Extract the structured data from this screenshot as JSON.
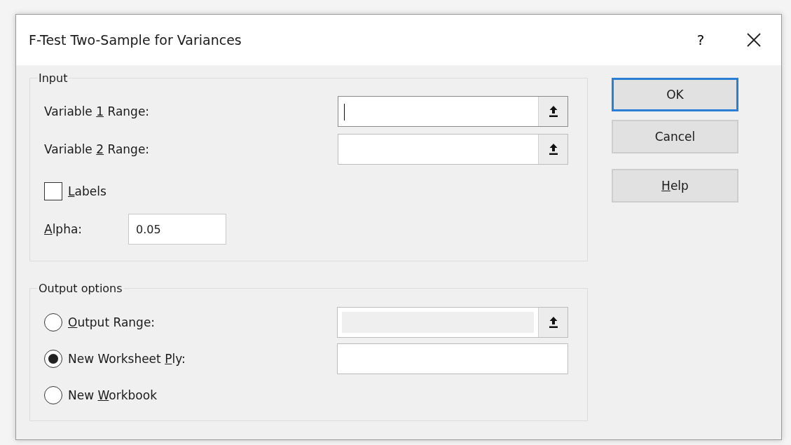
{
  "window": {
    "title": "F-Test Two-Sample for Variances",
    "help_glyph": "?"
  },
  "input_group": {
    "title": "Input",
    "range_fields": [
      {
        "label_start": "Variable ",
        "access_key": "1",
        "label_end": " Range:",
        "focused": true
      },
      {
        "label_start": "Variable ",
        "access_key": "2",
        "label_end": " Range:",
        "focused": false
      }
    ],
    "labels_checkbox": {
      "access_key": "L",
      "label_end": "abels",
      "checked": false
    },
    "alpha": {
      "access_key": "A",
      "label_end": "lpha:",
      "value": "0.05"
    }
  },
  "output_group": {
    "title": "Output options",
    "options": [
      {
        "access_key": "O",
        "label_end": "utput Range:",
        "selected": false,
        "field": {
          "kind": "range",
          "disabled": true
        }
      },
      {
        "label_start": "New Worksheet ",
        "access_key": "P",
        "label_end": "ly:",
        "selected": true,
        "field": {
          "kind": "text",
          "disabled": false
        }
      },
      {
        "label_start": "New ",
        "access_key": "W",
        "label_end": "orkbook",
        "selected": false
      }
    ]
  },
  "buttons": [
    {
      "label_start": "OK",
      "default": true
    },
    {
      "label_start": "Cancel",
      "default": false
    },
    {
      "access_key": "H",
      "label_end": "elp",
      "default": false
    }
  ]
}
